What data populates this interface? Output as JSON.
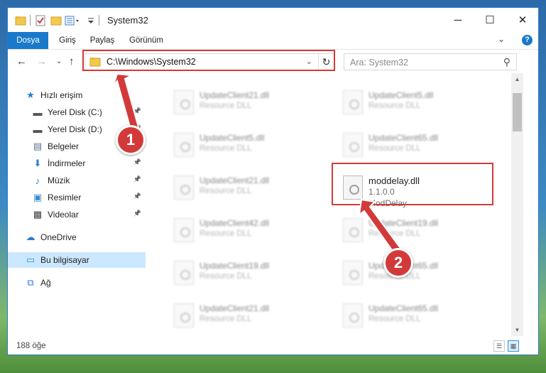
{
  "window": {
    "title": "System32"
  },
  "ribbon": {
    "tabs": [
      "Dosya",
      "Giriş",
      "Paylaş",
      "Görünüm"
    ],
    "help_label": "?"
  },
  "nav": {
    "address": "C:\\Windows\\System32",
    "search_placeholder": "Ara: System32"
  },
  "sidebar": {
    "items": [
      {
        "label": "Hızlı erişim",
        "icon": "star-icon"
      },
      {
        "label": "Yerel Disk (C:)",
        "icon": "drive-icon",
        "pinned": true
      },
      {
        "label": "Yerel Disk (D:)",
        "icon": "drive-icon",
        "pinned": true
      },
      {
        "label": "Belgeler",
        "icon": "documents-icon",
        "pinned": true
      },
      {
        "label": "İndirmeler",
        "icon": "downloads-icon",
        "pinned": true
      },
      {
        "label": "Müzik",
        "icon": "music-icon",
        "pinned": true
      },
      {
        "label": "Resimler",
        "icon": "pictures-icon",
        "pinned": true
      },
      {
        "label": "Videolar",
        "icon": "videos-icon",
        "pinned": true
      },
      {
        "label": "OneDrive",
        "icon": "cloud-icon"
      },
      {
        "label": "Bu bilgisayar",
        "icon": "computer-icon",
        "selected": true
      },
      {
        "label": "Ağ",
        "icon": "network-icon"
      }
    ]
  },
  "files": [
    {
      "name": "UpdateClient21.dll",
      "type": "Resource DLL"
    },
    {
      "name": "UpdateClient5.dll",
      "type": "Resource DLL"
    },
    {
      "name": "UpdateClient5.dll",
      "type": "Resource DLL"
    },
    {
      "name": "UpdateClient65.dll",
      "type": "Resource DLL"
    },
    {
      "name": "UpdateClient21.dll",
      "type": "Resource DLL"
    },
    {
      "name": "moddelay.dll",
      "version": "1.1.0.0",
      "type": "ModDelay"
    },
    {
      "name": "UpdateClient42.dll",
      "type": "Resource DLL"
    },
    {
      "name": "UpdateClient19.dll",
      "type": "Resource DLL"
    },
    {
      "name": "UpdateClient19.dll",
      "type": "Resource DLL"
    },
    {
      "name": "UpdateClient65.dll",
      "type": "Resource DLL"
    },
    {
      "name": "UpdateClient21.dll",
      "type": "Resource DLL"
    },
    {
      "name": "UpdateClient65.dll",
      "type": "Resource DLL"
    }
  ],
  "status": {
    "item_count": "188 öğe"
  },
  "annotations": {
    "step1": "1",
    "step2": "2",
    "color": "#d23a3a"
  }
}
